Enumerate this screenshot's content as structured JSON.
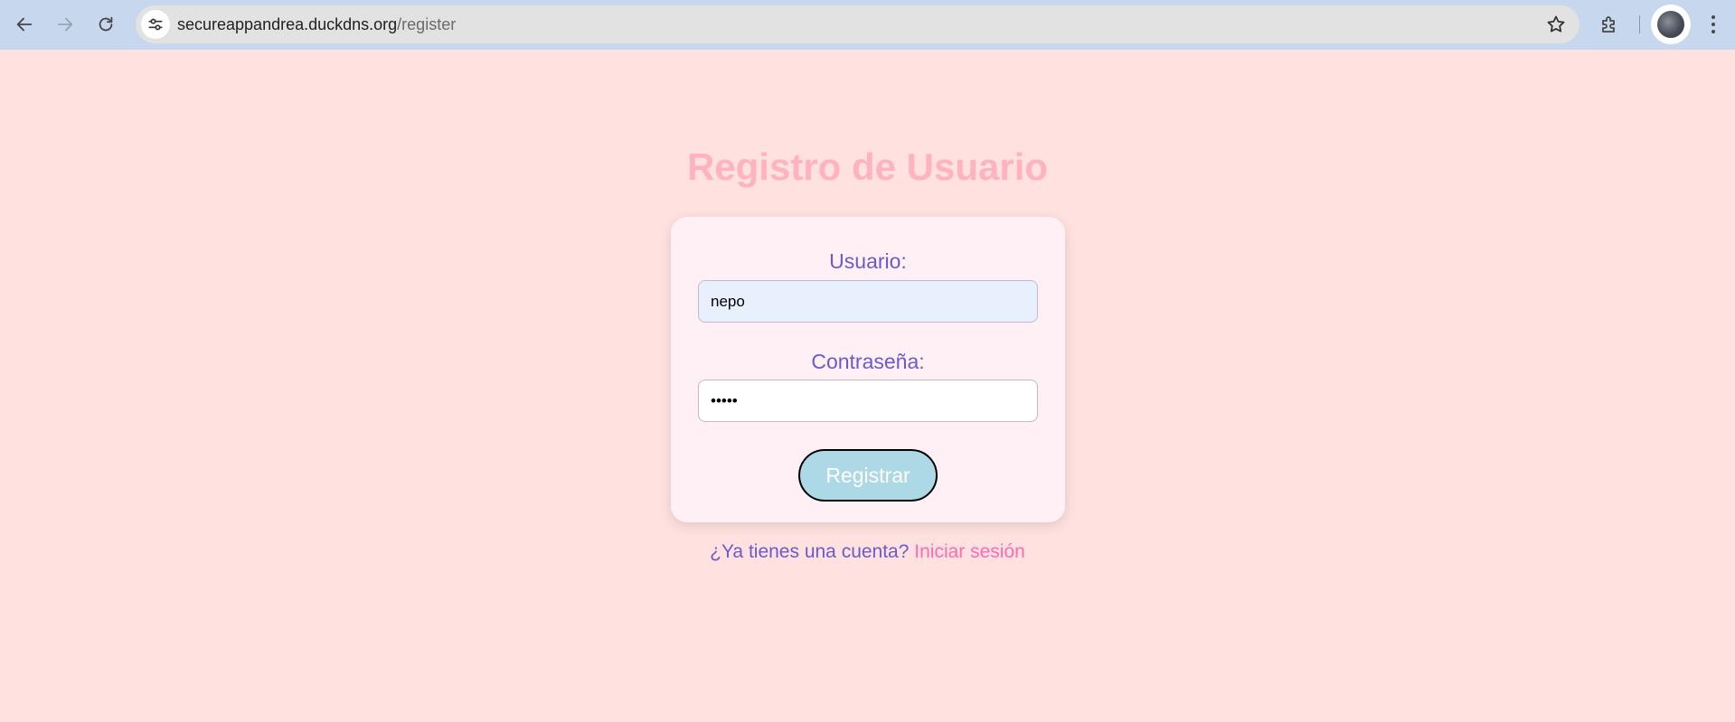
{
  "browser": {
    "url_host": "secureappandrea.duckdns.org",
    "url_path": "/register",
    "icons": {
      "back": "arrow-left-icon",
      "forward": "arrow-right-icon",
      "reload": "reload-icon",
      "site_info": "tune-icon",
      "bookmark": "star-icon",
      "extensions": "puzzle-icon",
      "profile": "avatar",
      "menu": "kebab-menu-icon"
    }
  },
  "page": {
    "title": "Registro de Usuario",
    "form": {
      "username_label": "Usuario:",
      "username_value": "nepo",
      "password_label": "Contraseña:",
      "password_value": "•••••",
      "submit_label": "Registrar"
    },
    "footer": {
      "prompt": "¿Ya tienes una cuenta?",
      "login_link": "Iniciar sesión"
    }
  },
  "colors": {
    "page_background": "#ffe2e0",
    "title": "#ffb3c1",
    "card_background": "#fff0f5",
    "label_text": "#6a5acd",
    "username_field_background": "#e8f0fe",
    "button_background": "#add8e6",
    "link": "#ff69b4",
    "browser_toolbar": "#c6d7ee"
  }
}
